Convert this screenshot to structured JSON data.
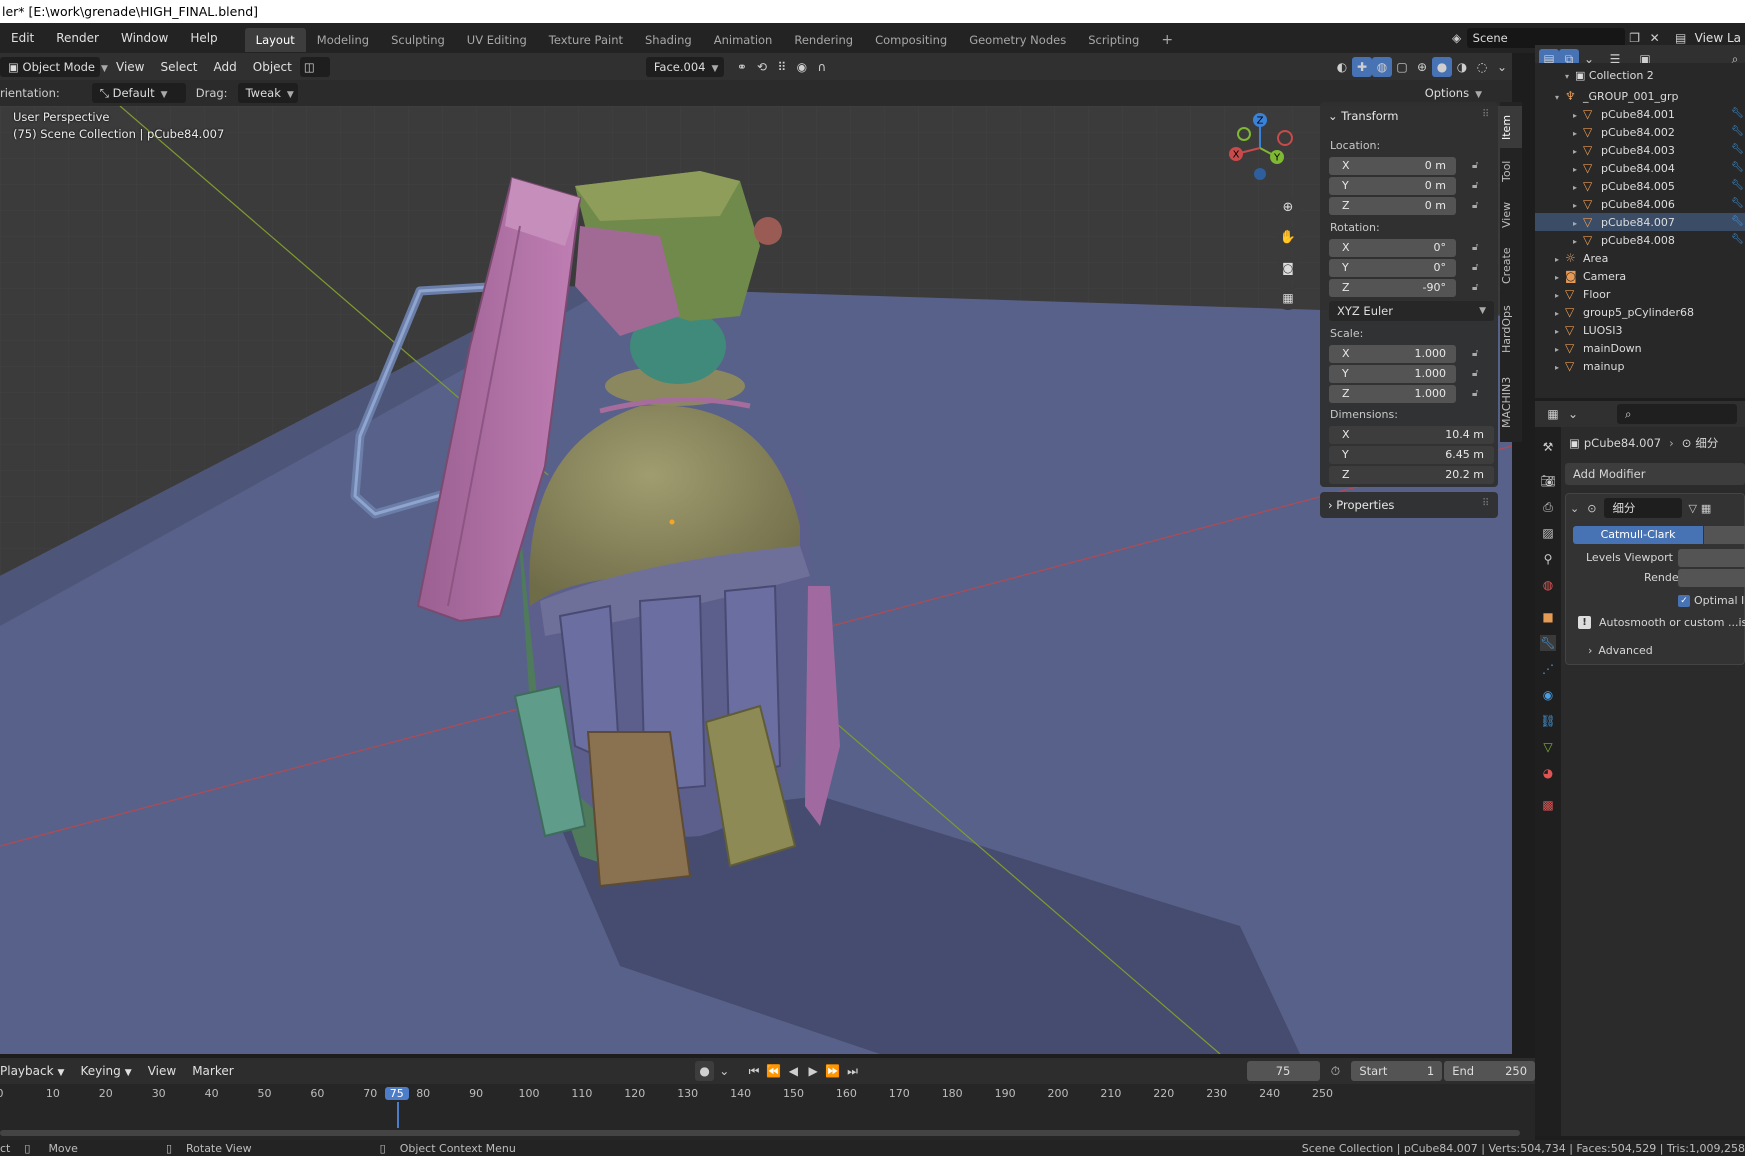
{
  "titlebar": {
    "text": "ler* [E:\\work\\grenade\\HIGH_FINAL.blend]"
  },
  "menu": {
    "items": [
      "Edit",
      "Render",
      "Window",
      "Help"
    ],
    "workspaces": [
      "Layout",
      "Modeling",
      "Sculpting",
      "UV Editing",
      "Texture Paint",
      "Shading",
      "Animation",
      "Rendering",
      "Compositing",
      "Geometry Nodes",
      "Scripting"
    ],
    "add_tab": "+",
    "scene": "Scene",
    "view_layer": "View La"
  },
  "viewport_header": {
    "mode": "Object Mode",
    "menus": [
      "View",
      "Select",
      "Add",
      "Object"
    ],
    "active_element": "Face.004"
  },
  "tool_header": {
    "orientation_label": "rientation:",
    "orientation_value": "Default",
    "drag_label": "Drag:",
    "drag_value": "Tweak",
    "options": "Options"
  },
  "viewport": {
    "perspective": "User Perspective",
    "collection_info": "(75) Scene Collection | pCube84.007",
    "gizmo_axes": {
      "x": "X",
      "y": "Y",
      "z": "Z"
    }
  },
  "npanel": {
    "transform_title": "Transform",
    "location_label": "Location:",
    "location": [
      {
        "axis": "X",
        "value": "0 m"
      },
      {
        "axis": "Y",
        "value": "0 m"
      },
      {
        "axis": "Z",
        "value": "0 m"
      }
    ],
    "rotation_label": "Rotation:",
    "rotation": [
      {
        "axis": "X",
        "value": "0°"
      },
      {
        "axis": "Y",
        "value": "0°"
      },
      {
        "axis": "Z",
        "value": "-90°"
      }
    ],
    "rotation_mode": "XYZ Euler",
    "scale_label": "Scale:",
    "scale": [
      {
        "axis": "X",
        "value": "1.000"
      },
      {
        "axis": "Y",
        "value": "1.000"
      },
      {
        "axis": "Z",
        "value": "1.000"
      }
    ],
    "dimensions_label": "Dimensions:",
    "dimensions": [
      {
        "axis": "X",
        "value": "10.4 m"
      },
      {
        "axis": "Y",
        "value": "6.45 m"
      },
      {
        "axis": "Z",
        "value": "20.2 m"
      }
    ],
    "properties_title": "Properties"
  },
  "side_tabs": [
    "Item",
    "Tool",
    "View",
    "Create",
    "HardOps",
    "MACHIN3"
  ],
  "outliner": {
    "top_item": "Collection 2",
    "items": [
      {
        "label": "_GROUP_001_grp",
        "indent": 1
      },
      {
        "label": "pCube84.001",
        "indent": 2
      },
      {
        "label": "pCube84.002",
        "indent": 2
      },
      {
        "label": "pCube84.003",
        "indent": 2
      },
      {
        "label": "pCube84.004",
        "indent": 2
      },
      {
        "label": "pCube84.005",
        "indent": 2
      },
      {
        "label": "pCube84.006",
        "indent": 2
      },
      {
        "label": "pCube84.007",
        "indent": 2,
        "selected": true
      },
      {
        "label": "pCube84.008",
        "indent": 2
      },
      {
        "label": "Area",
        "indent": 1
      },
      {
        "label": "Camera",
        "indent": 1
      },
      {
        "label": "Floor",
        "indent": 1
      },
      {
        "label": "group5_pCylinder68",
        "indent": 1
      },
      {
        "label": "LUOSI3",
        "indent": 1
      },
      {
        "label": "mainDown",
        "indent": 1
      },
      {
        "label": "mainup",
        "indent": 1
      }
    ]
  },
  "properties": {
    "object_name": "pCube84.007",
    "modifier_crumb": "细分",
    "add_modifier": "Add Modifier",
    "modifier_name": "细分",
    "subdiv_type": "Catmull-Clark",
    "levels_viewport_label": "Levels Viewport",
    "render_label": "Render",
    "optimal_label": "Optimal I",
    "autosmooth_msg": "Autosmooth or custom ...isab",
    "advanced_label": "Advanced"
  },
  "timeline": {
    "menus": [
      "Playback",
      "Keying",
      "View",
      "Marker"
    ],
    "current_frame": "75",
    "start_label": "Start",
    "start_value": "1",
    "end_label": "End",
    "end_value": "250",
    "ticks": [
      "0",
      "10",
      "20",
      "30",
      "40",
      "50",
      "60",
      "70",
      "75",
      "80",
      "90",
      "100",
      "110",
      "120",
      "130",
      "140",
      "150",
      "160",
      "170",
      "180",
      "190",
      "200",
      "210",
      "220",
      "230",
      "240",
      "250"
    ]
  },
  "statusbar": {
    "left_fragment": "ct",
    "move": "Move",
    "rotate": "Rotate View",
    "context": "Object Context Menu",
    "stats": "Scene Collection | pCube84.007 | Verts:504,734 | Faces:504,529 | Tris:1,009,258"
  },
  "colors": {
    "accent_blue": "#4772b3",
    "selected_frame": "#4d7cc9",
    "axis_red": "#c94a4a",
    "axis_green": "#7fb832",
    "axis_blue": "#3a82d8",
    "lever": "#b06fa4",
    "body": "#8b8860",
    "ring": "#5c5f8c",
    "floor": "#58618a"
  }
}
